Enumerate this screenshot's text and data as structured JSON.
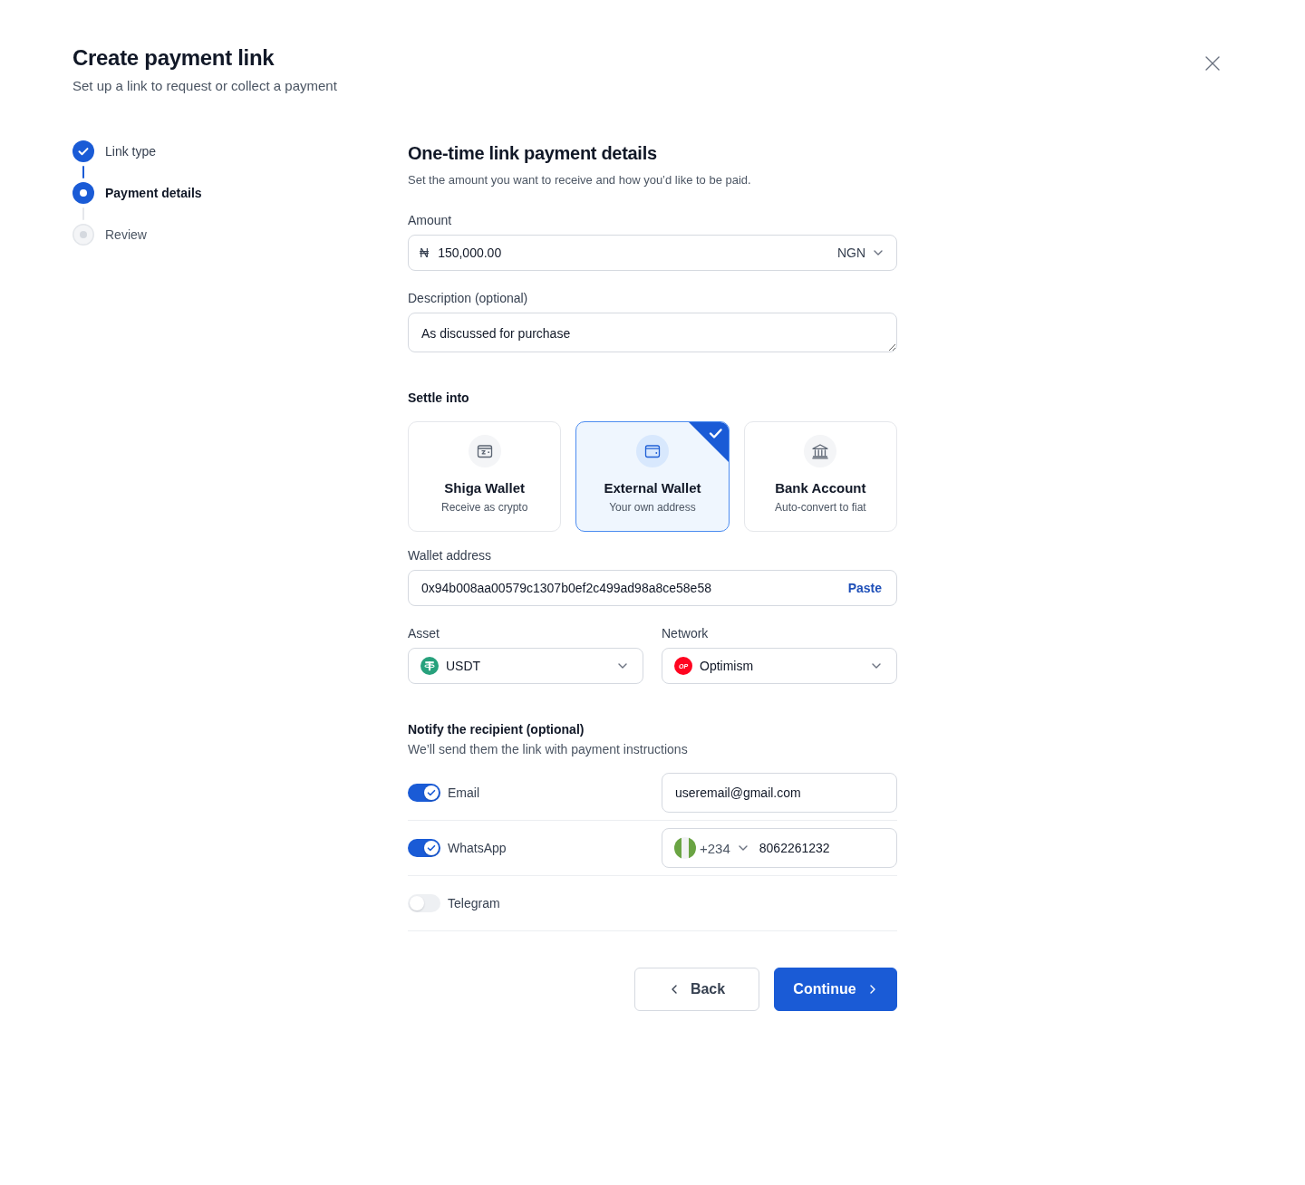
{
  "dialog": {
    "title": "Create payment link",
    "subtitle": "Set up a link to request or collect a payment"
  },
  "steps": [
    {
      "label": "Link type",
      "completed": true,
      "selected": false
    },
    {
      "label": "Payment details",
      "completed": false,
      "selected": true
    },
    {
      "label": "Review",
      "completed": false,
      "selected": false
    }
  ],
  "details": {
    "title": "One-time link payment details",
    "subtitle": "Set the amount you want to receive and how you’d like to be paid."
  },
  "amount": {
    "label": "Amount",
    "currency_symbol": "₦",
    "value": "150,000.00",
    "currency": "NGN"
  },
  "description": {
    "label": "Description (optional)",
    "value": "As discussed for purchase"
  },
  "settle_into": {
    "label": "Settle into",
    "options": [
      {
        "kind": "crypto",
        "title": "Shiga Wallet",
        "subtitle": "Receive as crypto",
        "selected": false
      },
      {
        "kind": "wallet",
        "title": "External Wallet",
        "subtitle": "Your own address",
        "selected": true
      },
      {
        "kind": "bank",
        "title": "Bank Account",
        "subtitle": "Auto-convert to fiat",
        "selected": false
      }
    ]
  },
  "wallet_address": {
    "label": "Wallet address",
    "value": "0x94b008aa00579c1307b0ef2c499ad98a8ce58e58",
    "action": "Paste"
  },
  "asset": {
    "label": "Asset",
    "value": "USDT"
  },
  "network": {
    "label": "Network",
    "value": "Optimism",
    "logo_text": "OP"
  },
  "notify": {
    "title": "Notify the recipient (optional)",
    "subtitle": "We’ll send them the link with payment instructions",
    "channels": [
      {
        "kind": "email",
        "label": "Email",
        "on": true,
        "value": "useremail@gmail.com"
      },
      {
        "kind": "phone",
        "label": "WhatsApp",
        "on": true,
        "dial_code": "+234",
        "value": "8062261232"
      },
      {
        "kind": "plain",
        "label": "Telegram",
        "on": false
      }
    ]
  },
  "buttons": [
    {
      "kind": "back",
      "label": "Back"
    },
    {
      "kind": "next",
      "label": "Continue"
    }
  ]
}
